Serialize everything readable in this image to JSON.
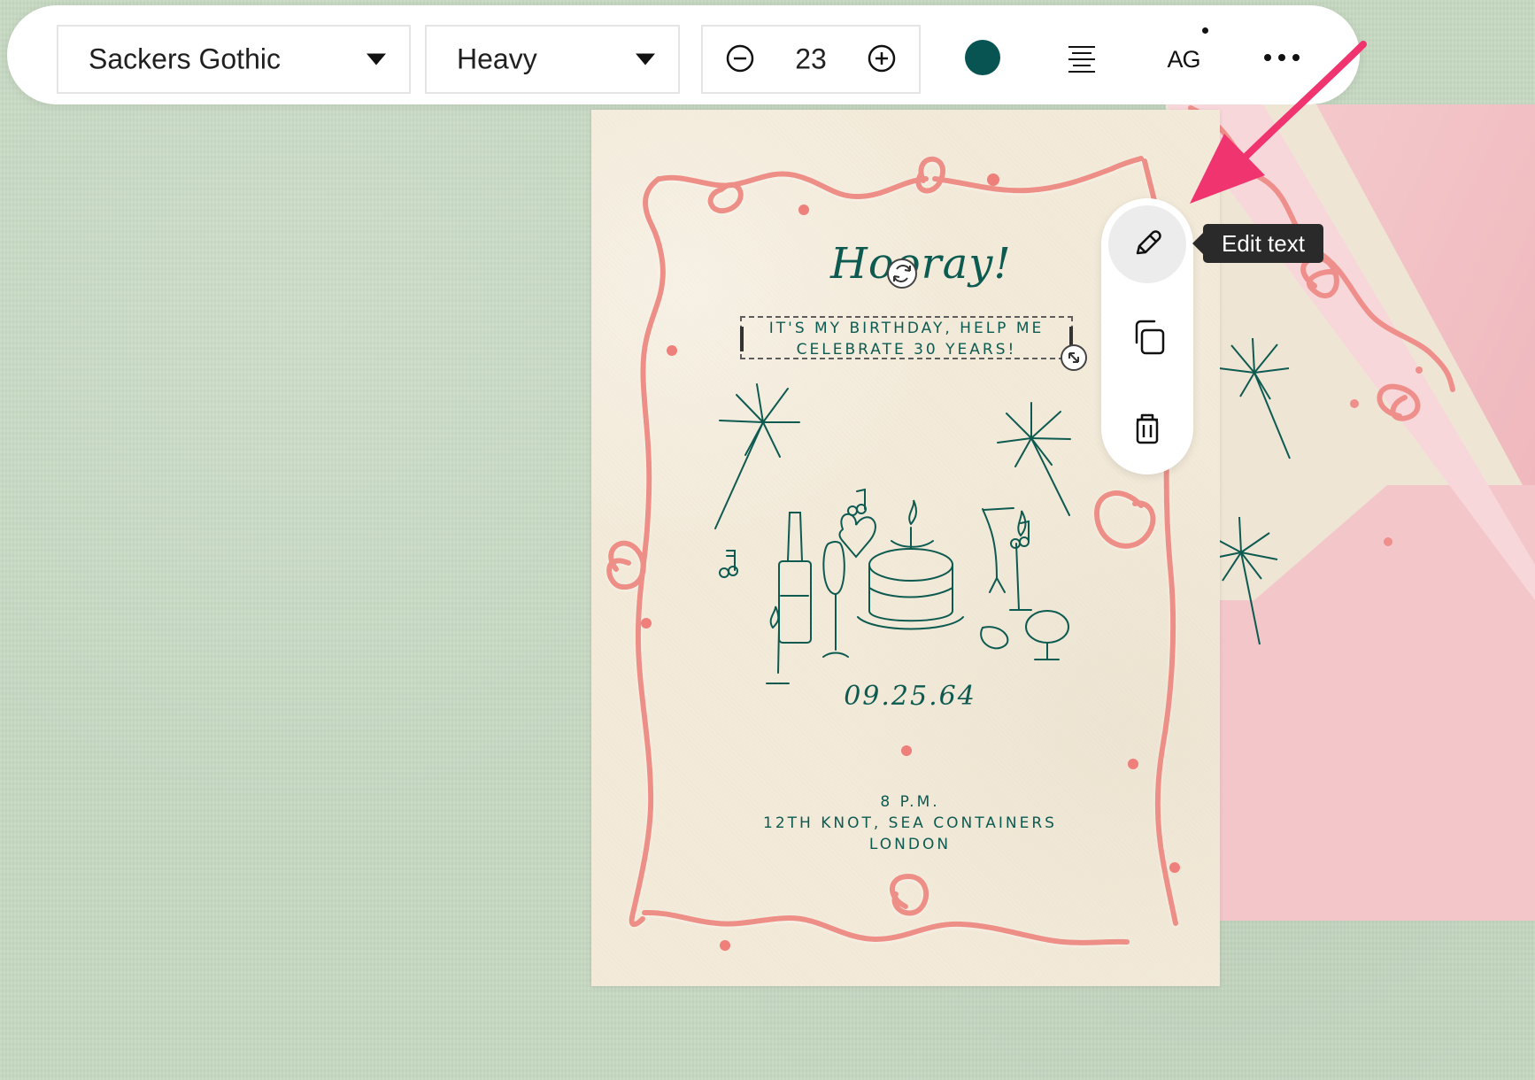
{
  "toolbar": {
    "font_family": "Sackers Gothic",
    "font_weight": "Heavy",
    "font_size": "23",
    "text_style": "AG",
    "color": "#075453"
  },
  "card": {
    "hooray": "Hooray!",
    "selected_text": {
      "line1": "IT'S MY BIRTHDAY, HELP ME",
      "line2": "CELEBRATE 30 YEARS!"
    },
    "date": "09.25.64",
    "details": {
      "time": "8 P.M.",
      "venue": "12TH KNOT, SEA CONTAINERS",
      "city": "LONDON"
    }
  },
  "context_menu": {
    "tooltip": "Edit text"
  },
  "colors": {
    "background": "#c7d9c3",
    "card": "#f3ead9",
    "ink": "#0d5a51",
    "ribbon": "#ef8c84",
    "envelope": "#f2bcc0",
    "accent_arrow": "#f03a72"
  },
  "icons": [
    "chevron-down-icon",
    "minus-circle-icon",
    "plus-circle-icon",
    "align-center-icon",
    "more-icon",
    "pencil-icon",
    "duplicate-icon",
    "trash-icon",
    "rotate-icon",
    "resize-icon"
  ]
}
